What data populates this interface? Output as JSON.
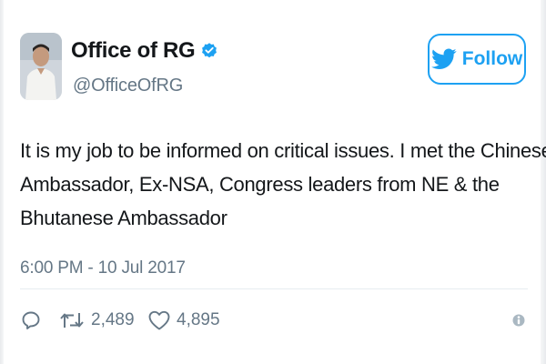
{
  "author": {
    "name": "Office of RG",
    "handle": "@OfficeOfRG",
    "verified": true
  },
  "follow_button": {
    "label": "Follow",
    "icon": "twitter-bird-icon"
  },
  "tweet": {
    "lines": [
      "It is my job to be informed on critical issues. I met the Chinese",
      "Ambassador, Ex-NSA, Congress leaders from NE & the",
      "Bhutanese Ambassador"
    ],
    "timestamp": "6:00 PM - 10 Jul 2017"
  },
  "actions": {
    "reply": {
      "icon": "reply-icon"
    },
    "retweet": {
      "icon": "retweet-icon",
      "count": "2,489"
    },
    "like": {
      "icon": "heart-icon",
      "count": "4,895"
    },
    "info": {
      "icon": "info-icon"
    }
  },
  "colors": {
    "accent": "#1da1f2",
    "text": "#14171a",
    "muted": "#657786"
  }
}
